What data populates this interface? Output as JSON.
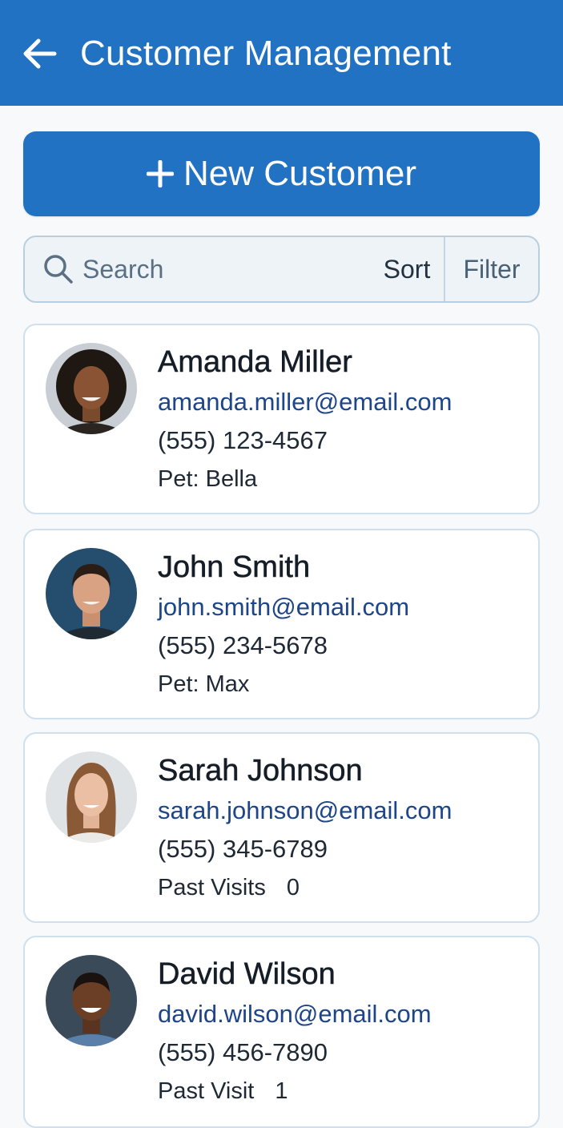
{
  "header": {
    "title": "Customer Management",
    "back_icon": "arrow-left-icon",
    "background": "#2272c3"
  },
  "new_customer": {
    "icon": "plus-icon",
    "label": "New Customer"
  },
  "search": {
    "placeholder": "Search",
    "value": "",
    "icon": "search-icon",
    "sort_label": "Sort",
    "filter_label": "Filter"
  },
  "customers": [
    {
      "name": "Amanda Miller",
      "email": "amanda.miller@email.com",
      "phone": "(555) 123-4567",
      "detail_label": "Pet: Bella",
      "detail_value": "",
      "avatar": "customer-photo-icon"
    },
    {
      "name": "John Smith",
      "email": "john.smith@email.com",
      "phone": "(555) 234-5678",
      "detail_label": "Pet: Max",
      "detail_value": "",
      "avatar": "customer-photo-icon"
    },
    {
      "name": "Sarah Johnson",
      "email": "sarah.johnson@email.com",
      "phone": "(555) 345-6789",
      "detail_label": "Past Visits",
      "detail_value": "0",
      "avatar": "customer-photo-icon"
    },
    {
      "name": "David Wilson",
      "email": "david.wilson@email.com",
      "phone": "(555) 456-7890",
      "detail_label": "Past Visit",
      "detail_value": "1",
      "avatar": "customer-photo-icon"
    }
  ],
  "colors": {
    "primary": "#2272c3",
    "email_link": "#1d4587",
    "card_border": "#cfe0ee",
    "background": "#f7f9fb"
  }
}
